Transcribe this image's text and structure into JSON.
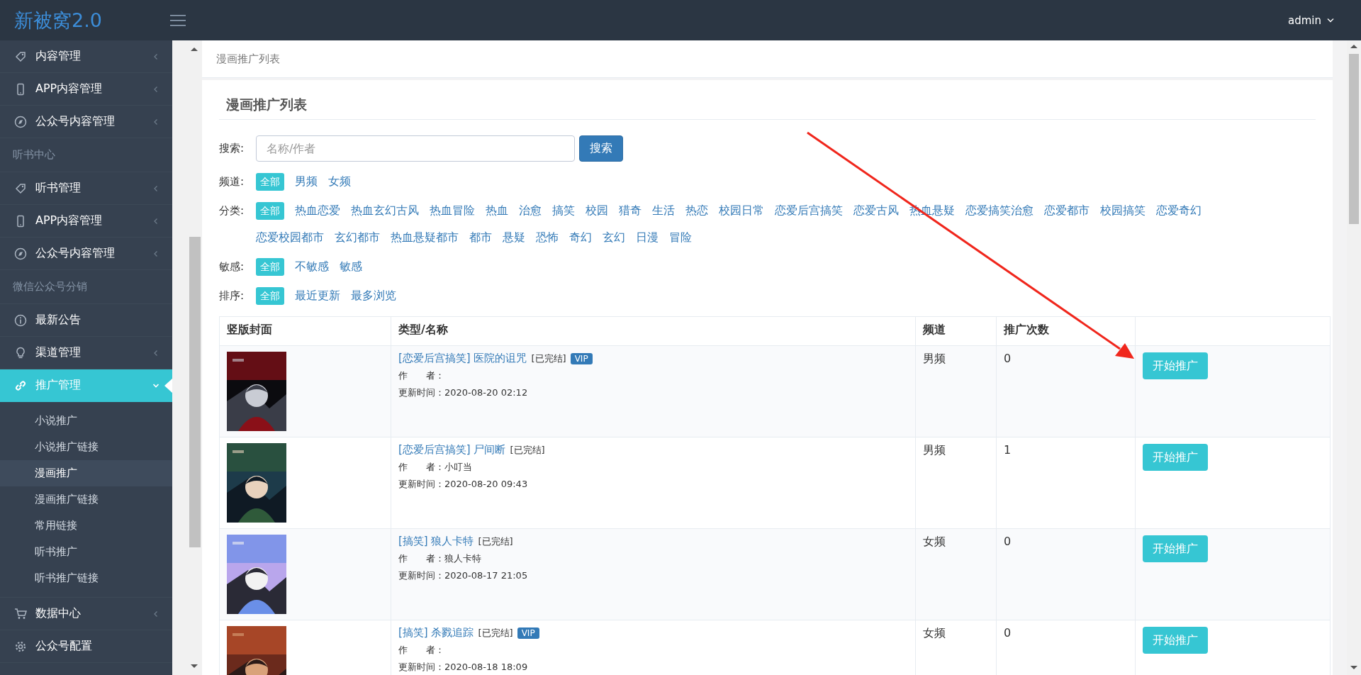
{
  "header": {
    "logo": "新被窝2.0",
    "user": "admin"
  },
  "sidebar": {
    "items": [
      {
        "kind": "menu",
        "label": "内容管理",
        "expanded": false,
        "selected": false
      },
      {
        "kind": "menu",
        "label": "APP内容管理",
        "expanded": false,
        "selected": false
      },
      {
        "kind": "menu",
        "label": "公众号内容管理",
        "expanded": false,
        "selected": false
      },
      {
        "kind": "header",
        "label": "听书中心"
      },
      {
        "kind": "menu",
        "label": "听书管理",
        "expanded": false,
        "selected": false
      },
      {
        "kind": "menu",
        "label": "APP内容管理",
        "expanded": false,
        "selected": false
      },
      {
        "kind": "menu",
        "label": "公众号内容管理",
        "expanded": false,
        "selected": false
      },
      {
        "kind": "header",
        "label": "微信公众号分销"
      },
      {
        "kind": "link",
        "label": "最新公告",
        "selected": false
      },
      {
        "kind": "menu",
        "label": "渠道管理",
        "expanded": false,
        "selected": false
      },
      {
        "kind": "menu",
        "label": "推广管理",
        "expanded": true,
        "selected": true,
        "children": [
          {
            "label": "小说推广",
            "selected": false
          },
          {
            "label": "小说推广链接",
            "selected": false
          },
          {
            "label": "漫画推广",
            "selected": true
          },
          {
            "label": "漫画推广链接",
            "selected": false
          },
          {
            "label": "常用链接",
            "selected": false
          },
          {
            "label": "听书推广",
            "selected": false
          },
          {
            "label": "听书推广链接",
            "selected": false
          }
        ]
      },
      {
        "kind": "menu",
        "label": "数据中心",
        "expanded": false,
        "selected": false
      },
      {
        "kind": "link",
        "label": "公众号配置",
        "selected": false
      }
    ]
  },
  "breadcrumb": "漫画推广列表",
  "panel": {
    "title": "漫画推广列表",
    "search": {
      "label": "搜索:",
      "placeholder": "名称/作者",
      "button": "搜索"
    },
    "filters": [
      {
        "label": "频道:",
        "options": [
          {
            "label": "全部",
            "selected": true
          },
          {
            "label": "男频",
            "selected": false
          },
          {
            "label": "女频",
            "selected": false
          }
        ]
      },
      {
        "label": "分类:",
        "options": [
          {
            "label": "全部",
            "selected": true
          },
          {
            "label": "热血恋爱",
            "selected": false
          },
          {
            "label": "热血玄幻古风",
            "selected": false
          },
          {
            "label": "热血冒险",
            "selected": false
          },
          {
            "label": "热血",
            "selected": false
          },
          {
            "label": "治愈",
            "selected": false
          },
          {
            "label": "搞笑",
            "selected": false
          },
          {
            "label": "校园",
            "selected": false
          },
          {
            "label": "猎奇",
            "selected": false
          },
          {
            "label": "生活",
            "selected": false
          },
          {
            "label": "热恋",
            "selected": false
          },
          {
            "label": "校园日常",
            "selected": false
          },
          {
            "label": "恋爱后宫搞笑",
            "selected": false
          },
          {
            "label": "恋爱古风",
            "selected": false
          },
          {
            "label": "热血悬疑",
            "selected": false
          },
          {
            "label": "恋爱搞笑治愈",
            "selected": false
          },
          {
            "label": "恋爱都市",
            "selected": false
          },
          {
            "label": "校园搞笑",
            "selected": false
          },
          {
            "label": "恋爱奇幻",
            "selected": false
          },
          {
            "label": "恋爱校园都市",
            "selected": false
          },
          {
            "label": "玄幻都市",
            "selected": false
          },
          {
            "label": "热血悬疑都市",
            "selected": false
          },
          {
            "label": "都市",
            "selected": false
          },
          {
            "label": "悬疑",
            "selected": false
          },
          {
            "label": "恐怖",
            "selected": false
          },
          {
            "label": "奇幻",
            "selected": false
          },
          {
            "label": "玄幻",
            "selected": false
          },
          {
            "label": "日漫",
            "selected": false
          },
          {
            "label": "冒险",
            "selected": false
          }
        ]
      },
      {
        "label": "敏感:",
        "options": [
          {
            "label": "全部",
            "selected": true
          },
          {
            "label": "不敏感",
            "selected": false
          },
          {
            "label": "敏感",
            "selected": false
          }
        ]
      },
      {
        "label": "排序:",
        "options": [
          {
            "label": "全部",
            "selected": true
          },
          {
            "label": "最近更新",
            "selected": false
          },
          {
            "label": "最多浏览",
            "selected": false
          }
        ]
      }
    ],
    "table": {
      "columns": [
        "竖版封面",
        "类型/名称",
        "频道",
        "推广次数"
      ],
      "rows": [
        {
          "title": "[恋爱后宫搞笑] 医院的诅咒",
          "status": "[已完结]",
          "badge": "VIP",
          "author_line": "作　　者：",
          "updated_line": "更新时间：2020-08-20 02:12",
          "channel": "男频",
          "count": "0",
          "action": "开始推广"
        },
        {
          "title": "[恋爱后宫搞笑] 尸间断",
          "status": "[已完结]",
          "author_line": "作　　者：小叮当",
          "updated_line": "更新时间：2020-08-20 09:43",
          "channel": "男频",
          "count": "1",
          "action": "开始推广"
        },
        {
          "title": "[搞笑] 狼人卡特",
          "status": "[已完结]",
          "author_line": "作　　者：狼人卡特",
          "updated_line": "更新时间：2020-08-17 21:05",
          "channel": "女频",
          "count": "0",
          "action": "开始推广"
        },
        {
          "title": "[搞笑] 杀戮追踪",
          "status": "[已完结]",
          "badge": "VIP",
          "author_line": "作　　者：",
          "updated_line": "更新时间：2020-08-18 18:09",
          "channel": "女频",
          "count": "0",
          "action": "开始推广"
        }
      ]
    }
  }
}
